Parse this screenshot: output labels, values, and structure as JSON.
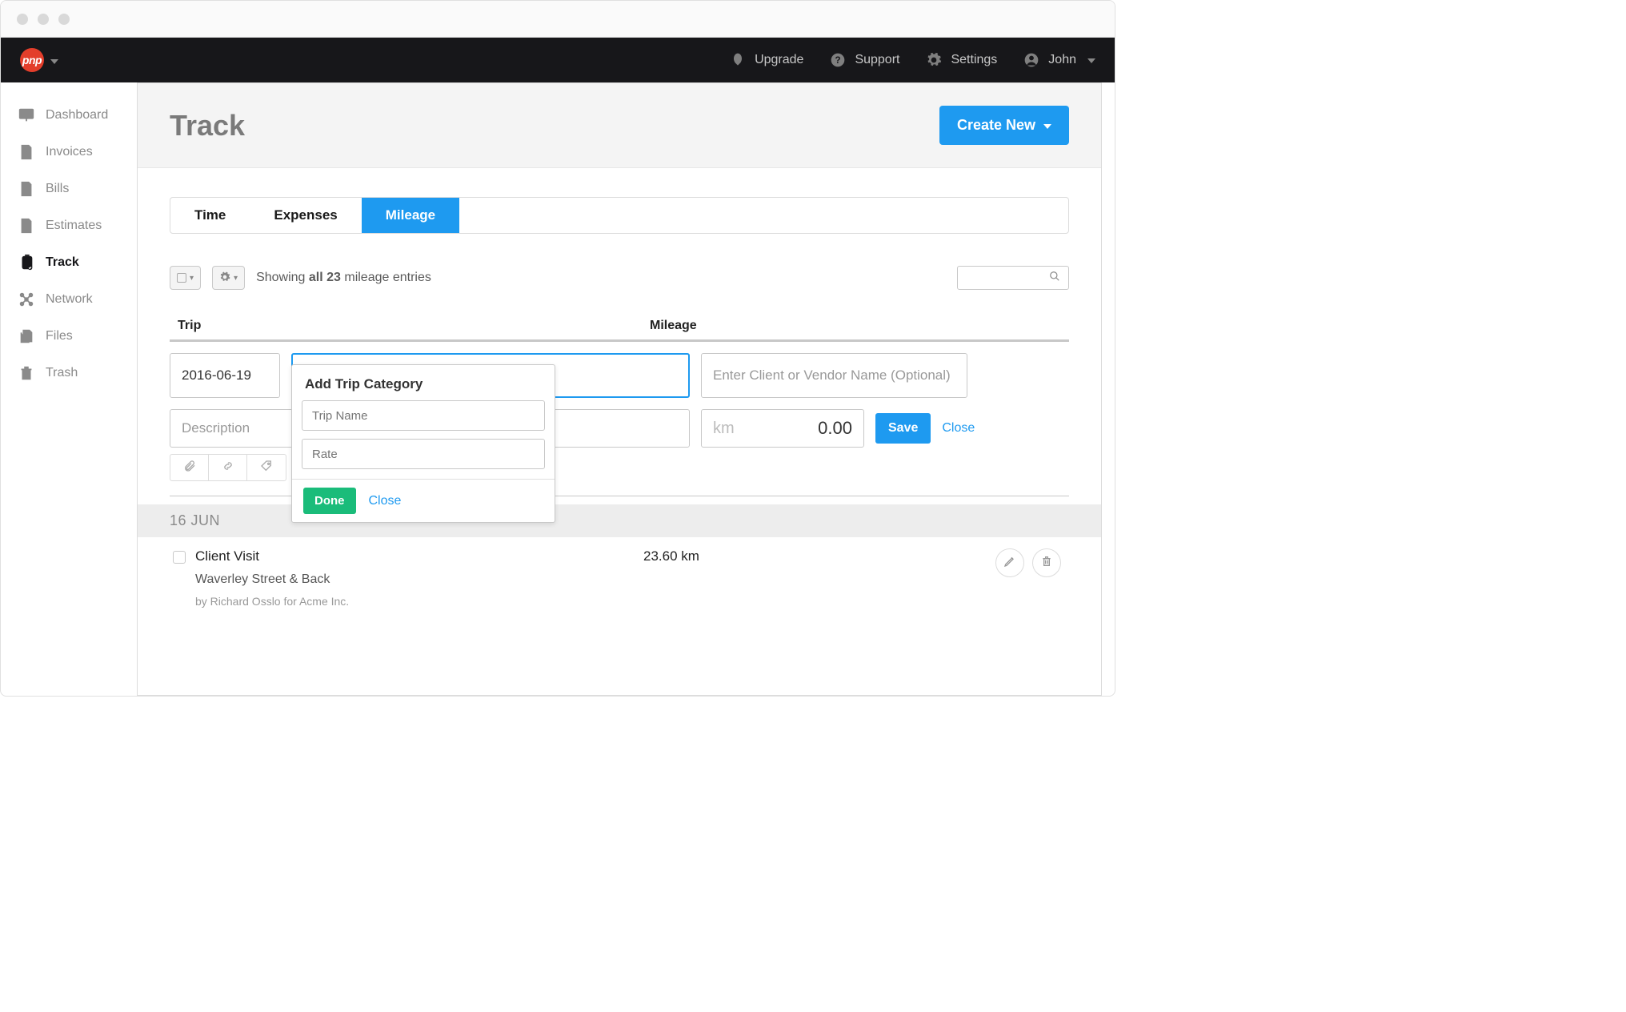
{
  "brand": {
    "label": "pnp"
  },
  "topnav": {
    "upgrade": "Upgrade",
    "support": "Support",
    "settings": "Settings",
    "user": "John"
  },
  "sidebar": {
    "items": [
      {
        "label": "Dashboard"
      },
      {
        "label": "Invoices"
      },
      {
        "label": "Bills"
      },
      {
        "label": "Estimates"
      },
      {
        "label": "Track"
      },
      {
        "label": "Network"
      },
      {
        "label": "Files"
      },
      {
        "label": "Trash"
      }
    ]
  },
  "page": {
    "title": "Track",
    "create_new": "Create New"
  },
  "tabs": {
    "time": "Time",
    "expenses": "Expenses",
    "mileage": "Mileage"
  },
  "toolbar": {
    "showing_prefix": "Showing ",
    "showing_bold": "all 23",
    "showing_suffix": " mileage entries"
  },
  "table": {
    "trip_header": "Trip",
    "mileage_header": "Mileage"
  },
  "entry": {
    "date": "2016-06-19",
    "client_placeholder": "Enter Client or Vendor Name (Optional)",
    "desc_placeholder": "Description",
    "km_unit": "km",
    "km_value": "0.00",
    "save": "Save",
    "close": "Close"
  },
  "popup": {
    "title": "Add Trip Category",
    "trip_name_placeholder": "Trip Name",
    "rate_placeholder": "Rate",
    "done": "Done",
    "close": "Close"
  },
  "groups": [
    {
      "header": "16 JUN"
    }
  ],
  "rows": [
    {
      "title": "Client Visit",
      "subtitle": "Waverley Street & Back",
      "byline": "by Richard Osslo for Acme Inc.",
      "mileage": "23.60 km"
    }
  ]
}
